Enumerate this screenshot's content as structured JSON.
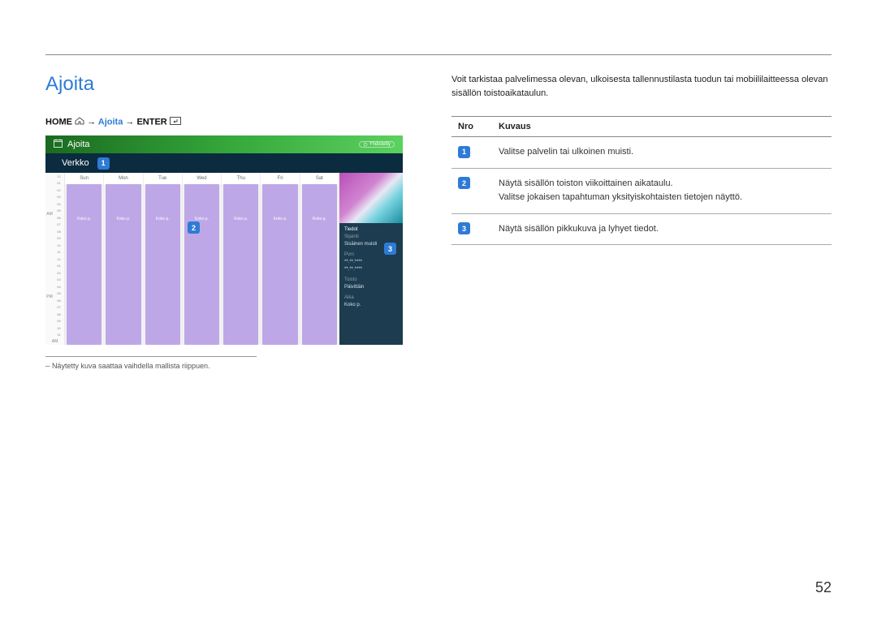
{
  "page": {
    "title": "Ajoita",
    "page_number": "52"
  },
  "breadcrumb": {
    "home": "HOME",
    "arrow": "→",
    "current": "Ajoita",
    "enter": "ENTER"
  },
  "screenshot": {
    "header_title": "Ajoita",
    "connected": "Yhdistetty",
    "sub_label": "Verkko",
    "days": [
      "Sun",
      "Mon",
      "Tue",
      "Wed",
      "Thu",
      "Fri",
      "Sat"
    ],
    "am": "AM",
    "pm": "PM",
    "hours": [
      "12",
      "01",
      "02",
      "03",
      "04",
      "05",
      "06",
      "07",
      "08",
      "09",
      "10",
      "11"
    ],
    "event_label": "Koko p.",
    "details": {
      "title": "Tiedot",
      "loc_label": "Sijainti",
      "loc_value": "Sisäinen muisti",
      "date_label": "Pvm",
      "date_value1": "**.**.****",
      "date_value2": "**.**.****",
      "repeat_label": "Toisto",
      "repeat_value": "Päivittäin",
      "time_label": "Aika",
      "time_value": "Koko p."
    },
    "callouts": {
      "c1": "1",
      "c2": "2",
      "c3": "3"
    }
  },
  "footnote": "Näytetty kuva saattaa vaihdella mallista riippuen.",
  "right": {
    "intro": "Voit tarkistaa palvelimessa olevan, ulkoisesta tallennustilasta tuodun tai mobiililaitteessa olevan sisällön toistoaikataulun.",
    "table": {
      "col1": "Nro",
      "col2": "Kuvaus",
      "rows": [
        {
          "num": "1",
          "desc": "Valitse palvelin tai ulkoinen muisti."
        },
        {
          "num": "2",
          "desc": "Näytä sisällön toiston viikoittainen aikataulu.\nValitse jokaisen tapahtuman yksityiskohtaisten tietojen näyttö."
        },
        {
          "num": "3",
          "desc": "Näytä sisällön pikkukuva ja lyhyet tiedot."
        }
      ]
    }
  }
}
